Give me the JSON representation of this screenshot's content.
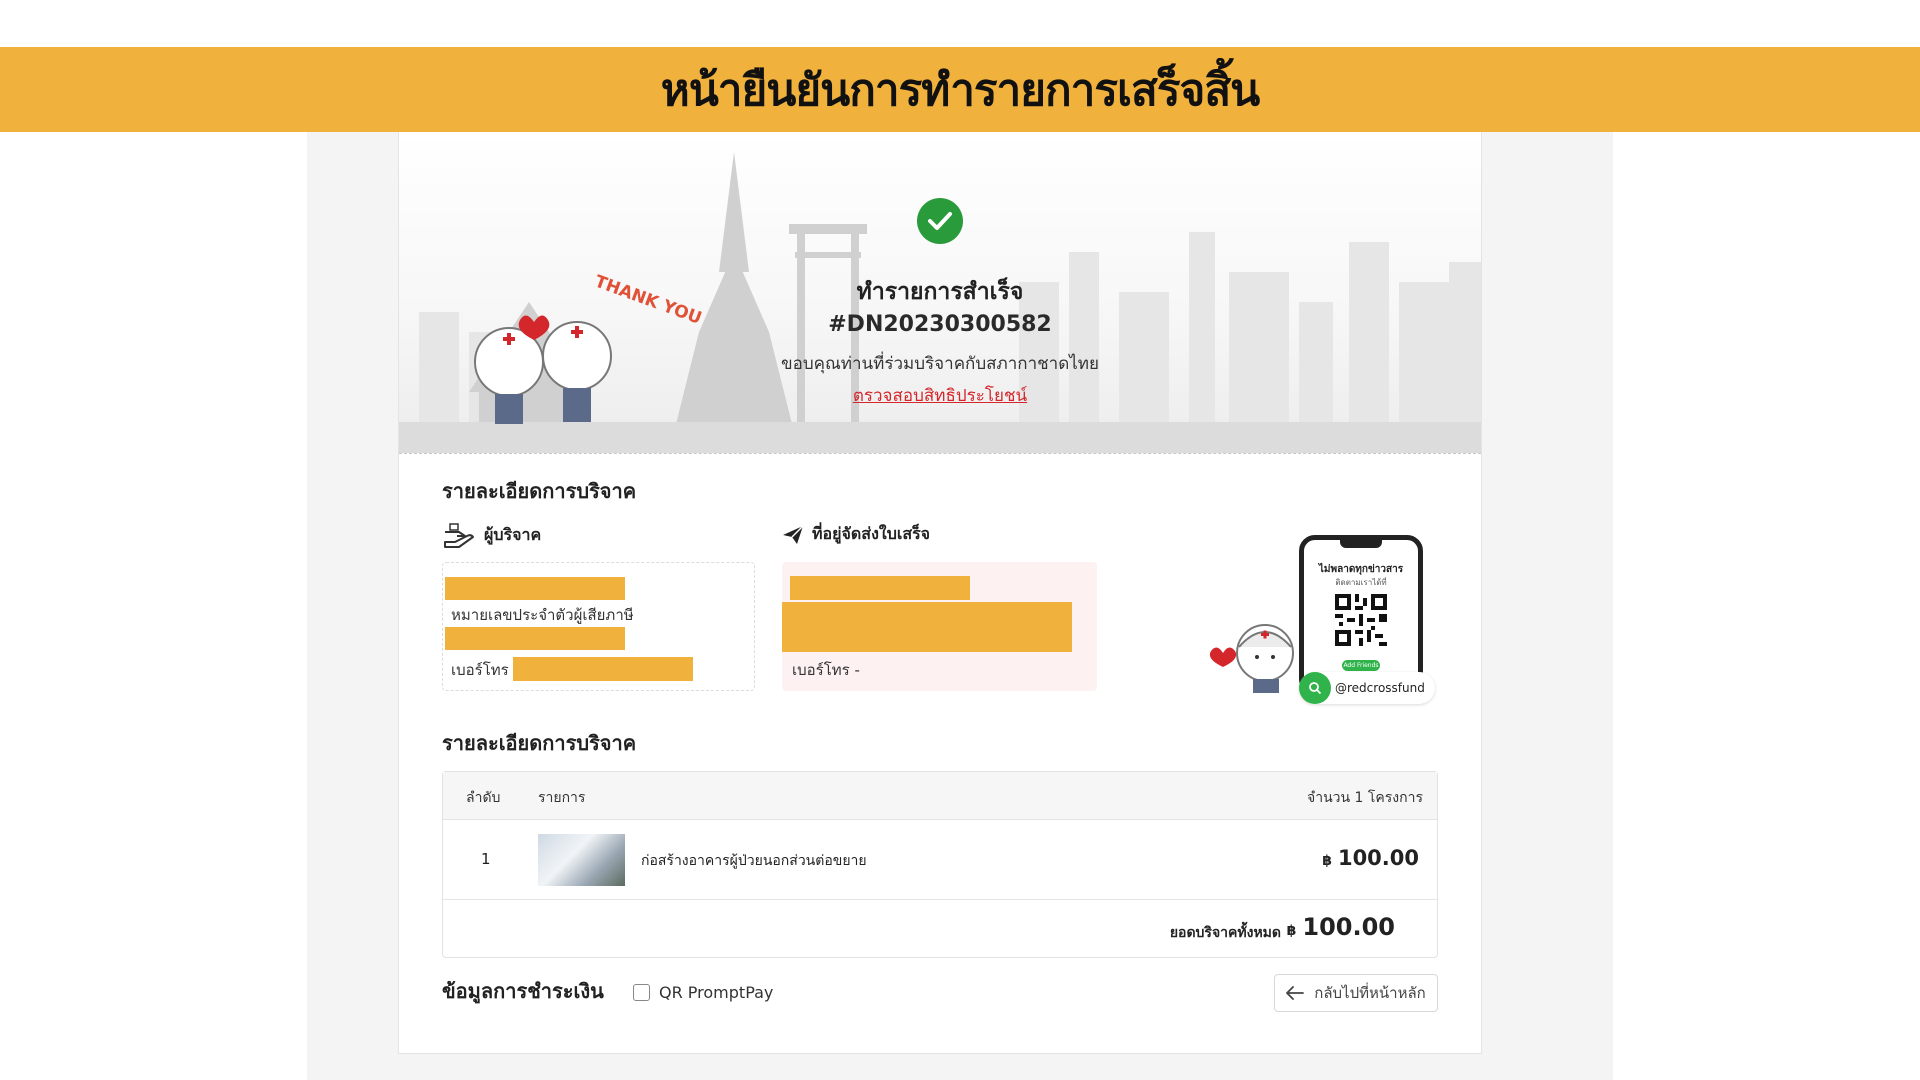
{
  "banner": {
    "title": "หน้ายืนยันการทำรายการเสร็จสิ้น"
  },
  "hero": {
    "title": "ทำรายการสำเร็จ",
    "reference": "#DN20230300582",
    "thanks": "ขอบคุณท่านที่ร่วมบริจาคกับสภากาชาดไทย",
    "benefit_link": "ตรวจสอบสิทธิประโยชน์",
    "sticker_text": "THANK YOU"
  },
  "donation_details": {
    "title": "รายละเอียดการบริจาค",
    "donor": {
      "heading": "ผู้บริจาค",
      "tax_id_label": "หมายเลขประจำตัวผู้เสียภาษี",
      "phone_label": "เบอร์โทร"
    },
    "address": {
      "heading": "ที่อยู่จัดส่งใบเสร็จ",
      "phone_label": "เบอร์โทร",
      "phone_value": "-"
    },
    "line_promo": {
      "headline": "ไม่พลาดทุกข่าวสาร",
      "subline": "ติดตามเราได้ที่",
      "add_friend": "Add Friends",
      "account": "@redcrossfund"
    }
  },
  "items_section": {
    "title": "รายละเอียดการบริจาค",
    "columns": {
      "index": "ลำดับ",
      "item": "รายการ",
      "count": "จำนวน 1 โครงการ"
    },
    "rows": [
      {
        "index": "1",
        "name": "ก่อสร้างอาคารผู้ป่วยนอกส่วนต่อขยาย",
        "currency": "฿",
        "amount": "100.00"
      }
    ],
    "total_label": "ยอดบริจาคทั้งหมด",
    "total_currency": "฿",
    "total_amount": "100.00"
  },
  "payment": {
    "title": "ข้อมูลการชำระเงิน",
    "method": "QR PromptPay",
    "method_selected": false
  },
  "back_button": {
    "label": "กลับไปที่หน้าหลัก"
  },
  "colors": {
    "accent": "#f1b13d",
    "success": "#2a9b3a",
    "link_red": "#d3272b",
    "line_green": "#2fb34a"
  }
}
